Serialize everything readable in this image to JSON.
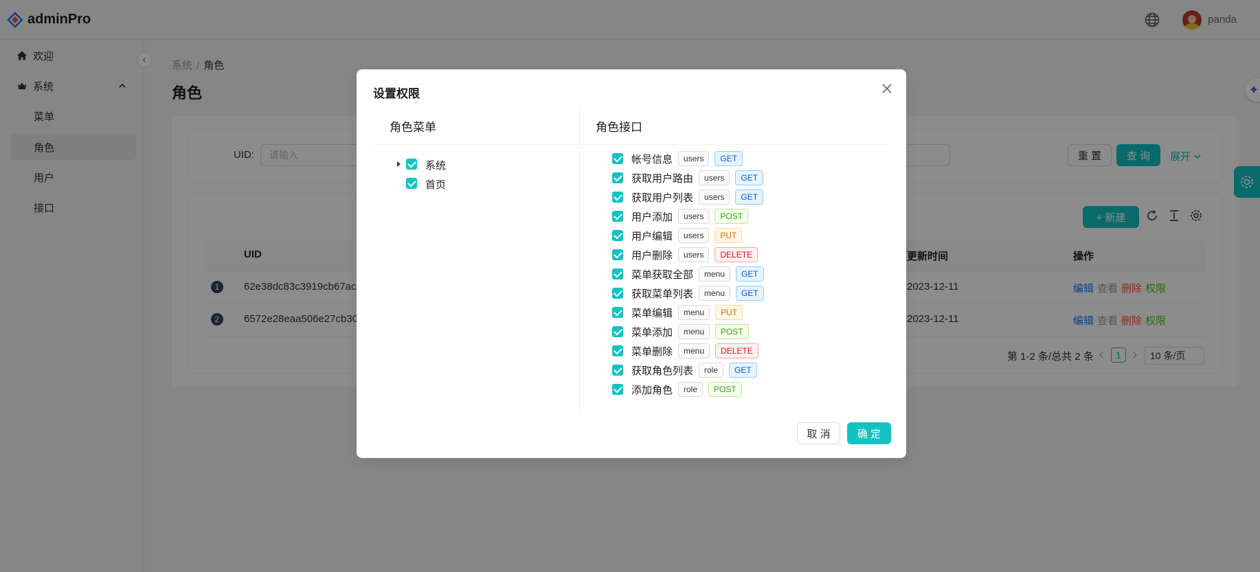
{
  "app": {
    "name": "adminPro",
    "username": "panda"
  },
  "sidebar": {
    "items": [
      {
        "label": "欢迎",
        "icon": "home-icon"
      },
      {
        "label": "系统",
        "icon": "crown-icon"
      },
      {
        "label": "菜单"
      },
      {
        "label": "角色"
      },
      {
        "label": "用户"
      },
      {
        "label": "接口"
      }
    ]
  },
  "breadcrumb": {
    "parent": "系统",
    "sep": "/",
    "current": "角色"
  },
  "page": {
    "title": "角色"
  },
  "search": {
    "uid_label": "UID:",
    "uid_placeholder": "请输入",
    "reset": "重 置",
    "query": "查 询",
    "expand": "展开"
  },
  "toolbar": {
    "new_label": "+ 新建"
  },
  "table": {
    "headers": {
      "uid": "UID",
      "updated": "更新时间",
      "actions": "操作"
    },
    "rows": [
      {
        "index": "1",
        "uid": "62e38dc83c3919cb67ac2b",
        "updated": "2023-12-11"
      },
      {
        "index": "2",
        "uid": "6572e28eaa506e27cb303",
        "updated": "2023-12-11"
      }
    ],
    "actions": {
      "edit": "编辑",
      "view": "查看",
      "delete": "删除",
      "perm": "权限"
    }
  },
  "pagination": {
    "summary": "第 1-2 条/总共 2 条",
    "current": "1",
    "page_size": "10 条/页"
  },
  "modal": {
    "title": "设置权限",
    "menu_col_title": "角色菜单",
    "api_col_title": "角色接口",
    "menu_tree": [
      "系统",
      "首页"
    ],
    "apis": [
      {
        "name": "帐号信息",
        "module": "users",
        "method": "GET"
      },
      {
        "name": "获取用户路由",
        "module": "users",
        "method": "GET"
      },
      {
        "name": "获取用户列表",
        "module": "users",
        "method": "GET"
      },
      {
        "name": "用户添加",
        "module": "users",
        "method": "POST"
      },
      {
        "name": "用户编辑",
        "module": "users",
        "method": "PUT"
      },
      {
        "name": "用户删除",
        "module": "users",
        "method": "DELETE"
      },
      {
        "name": "菜单获取全部",
        "module": "menu",
        "method": "GET"
      },
      {
        "name": "获取菜单列表",
        "module": "menu",
        "method": "GET"
      },
      {
        "name": "菜单编辑",
        "module": "menu",
        "method": "PUT"
      },
      {
        "name": "菜单添加",
        "module": "menu",
        "method": "POST"
      },
      {
        "name": "菜单删除",
        "module": "menu",
        "method": "DELETE"
      },
      {
        "name": "获取角色列表",
        "module": "role",
        "method": "GET"
      },
      {
        "name": "添加角色",
        "module": "role",
        "method": "POST"
      }
    ],
    "cancel": "取 消",
    "ok": "确 定"
  },
  "colors": {
    "primary": "#13c2c2",
    "edit": "#1677ff",
    "delete": "#ff4d4f",
    "perm": "#52c41a",
    "view": "#999999"
  }
}
